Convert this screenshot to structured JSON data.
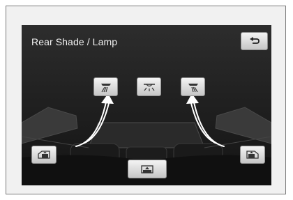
{
  "screen": {
    "title": "Rear Shade / Lamp"
  },
  "icons": {
    "back": "return-arrow-icon",
    "lamp_left": "rear-left-reading-lamp-icon",
    "lamp_center": "rear-dome-lamp-icon",
    "lamp_right": "rear-right-reading-lamp-icon",
    "shade_left": "left-side-shade-icon",
    "shade_rear": "rear-window-shade-icon",
    "shade_right": "right-side-shade-icon"
  },
  "colors": {
    "screen_background": "#222222",
    "button_face": "#e2e2e2",
    "arrow": "#ffffff"
  }
}
